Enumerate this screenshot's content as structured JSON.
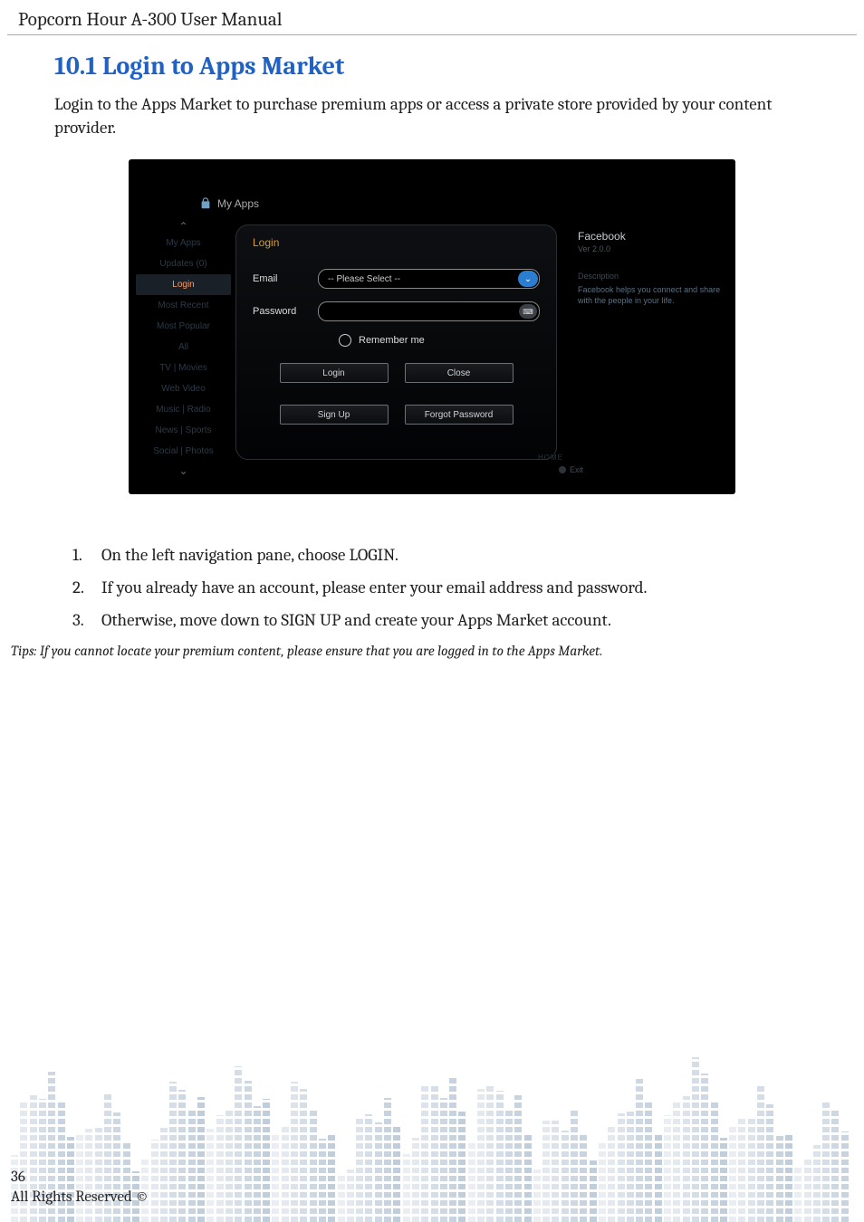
{
  "header": "Popcorn Hour A-300 User Manual",
  "section_title": "10.1 Login to Apps Market",
  "intro": "Login to the Apps Market to purchase premium apps or access a private store provided by your content provider.",
  "screenshot": {
    "topbar_label": "My Apps",
    "sidebar": {
      "items": [
        "My Apps",
        "Updates (0)",
        "Login",
        "Most Recent",
        "Most Popular",
        "All",
        "TV | Movies",
        "Web Video",
        "Music | Radio",
        "News | Sports",
        "Social | Photos"
      ],
      "selected_index": 2
    },
    "card": {
      "title": "Login",
      "email_label": "Email",
      "email_placeholder": "-- Please Select --",
      "password_label": "Password",
      "remember_label": "Remember me",
      "login_btn": "Login",
      "close_btn": "Close",
      "signup_btn": "Sign Up",
      "forgot_btn": "Forgot Password"
    },
    "right": {
      "app_name": "Facebook",
      "version": "Ver 2.0.0",
      "desc_label": "Description",
      "desc": "Facebook helps you connect and share with the people in your life."
    },
    "home_hint": "HOME",
    "exit_hint": "Exit"
  },
  "steps": [
    "On the left navigation pane, choose LOGIN.",
    "If you already have an account, please enter your email address and password.",
    "Otherwise, move down to SIGN UP and create your Apps Market account."
  ],
  "tips": "Tips: If you cannot locate your premium content, please ensure that you are logged in to the Apps Market.",
  "footer": {
    "page_number": "36",
    "rights": "All Rights Reserved ©"
  }
}
